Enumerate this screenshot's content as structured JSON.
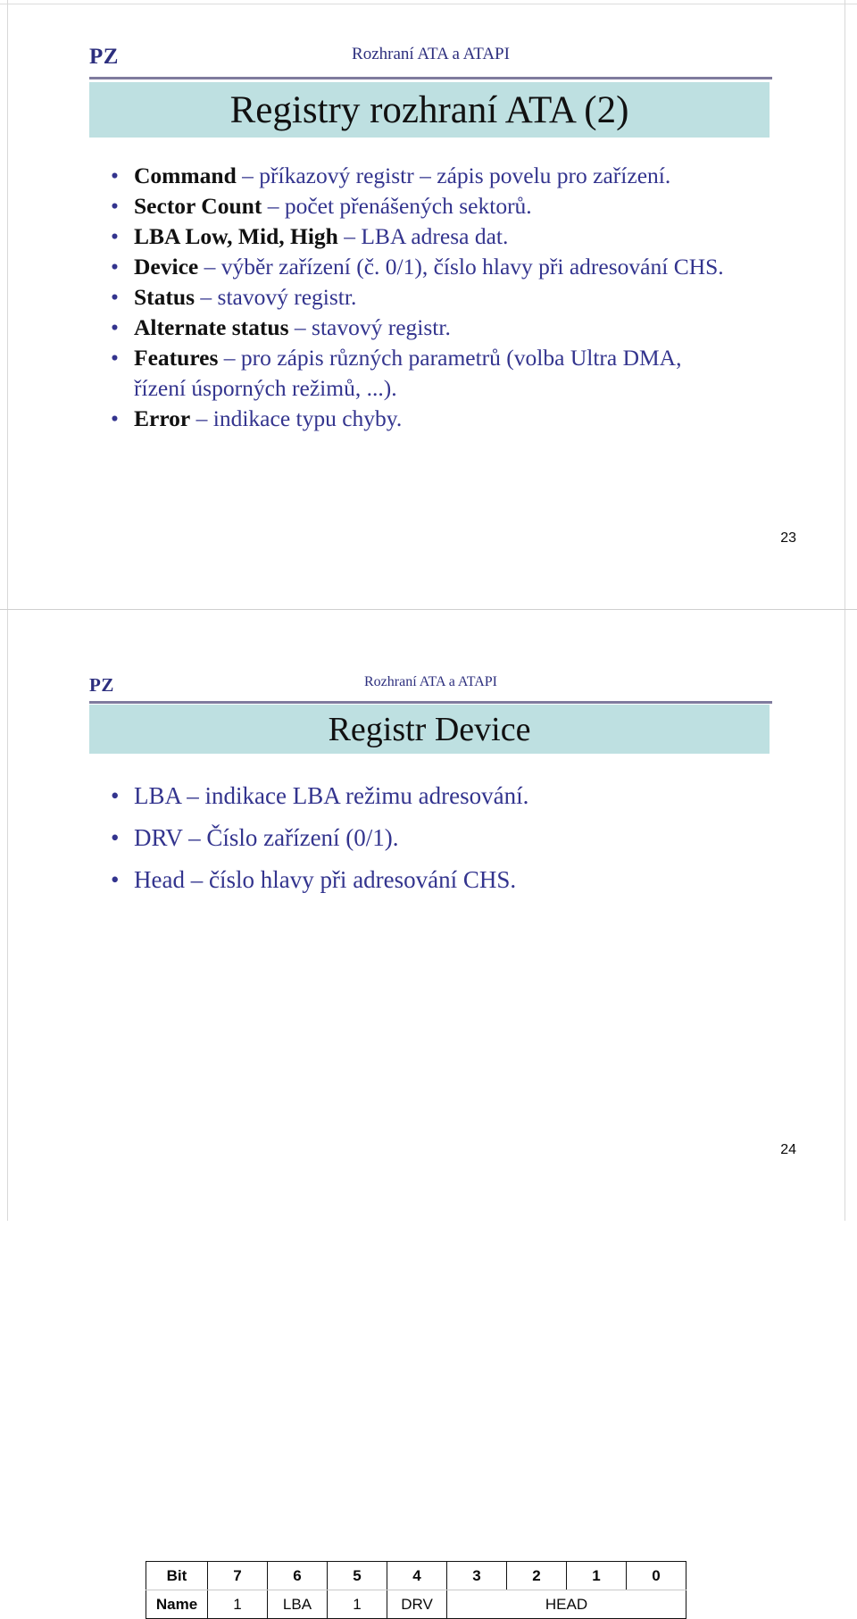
{
  "colors": {
    "accent_navy": "#2d2f7e",
    "body_blue": "#33348e",
    "title_band": "#bee0e1",
    "header_rule": "#7f7b9e",
    "text_black": "#111111"
  },
  "slides": [
    {
      "header": {
        "logo": "PZ",
        "subject": "Rozhraní ATA a ATAPI"
      },
      "title": "Registry rozhraní ATA (2)",
      "bullets": [
        {
          "term": "Command",
          "dash": " – ",
          "desc": "příkazový registr – zápis povelu pro zařízení."
        },
        {
          "term": "Sector Count",
          "dash": " – ",
          "desc": "počet přenášených sektorů."
        },
        {
          "term": "LBA Low, Mid, High",
          "dash": " – ",
          "desc": "LBA adresa dat."
        },
        {
          "term": "Device",
          "dash": " – ",
          "desc": "výběr zařízení (č. 0/1), číslo hlavy při adresování CHS."
        },
        {
          "term": "Status",
          "dash": " – ",
          "desc": "stavový registr."
        },
        {
          "term": "Alternate status",
          "dash": " – ",
          "desc": "stavový registr."
        },
        {
          "term": "Features",
          "dash": " – ",
          "desc": "pro zápis různých parametrů (volba Ultra DMA,",
          "desc2": "řízení úsporných režimů, ...)."
        },
        {
          "term": "Error",
          "dash": " – ",
          "desc": "indikace typu chyby."
        }
      ],
      "page_number": "23"
    },
    {
      "header": {
        "logo": "PZ",
        "subject": "Rozhraní ATA a ATAPI"
      },
      "title": "Registr Device",
      "bullets": [
        {
          "text": "LBA – indikace LBA režimu adresování."
        },
        {
          "text": "DRV – Číslo zařízení (0/1)."
        },
        {
          "text": "Head – číslo hlavy při adresování CHS."
        }
      ],
      "page_number": "24"
    }
  ],
  "bit_table": {
    "row_labels": {
      "bit": "Bit",
      "name": "Name"
    },
    "bits": [
      "7",
      "6",
      "5",
      "4",
      "3",
      "2",
      "1",
      "0"
    ],
    "names": [
      "1",
      "LBA",
      "1",
      "DRV",
      "HEAD"
    ],
    "head_span": 4
  }
}
